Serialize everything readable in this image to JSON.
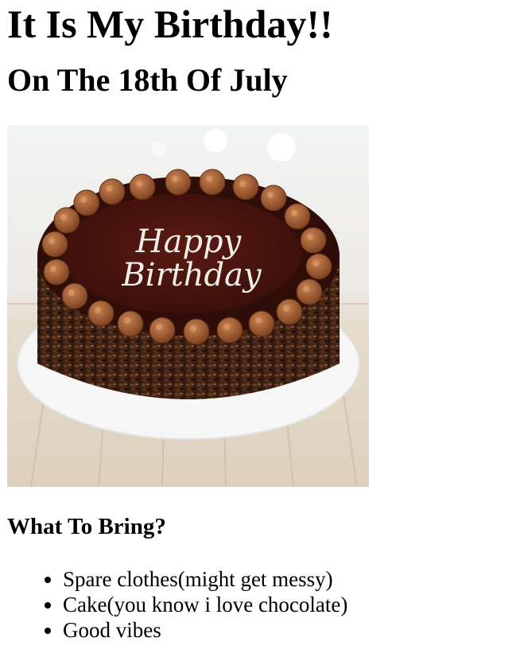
{
  "heading": "It Is My Birthday!!",
  "subheading": "On The 18th Of July",
  "image": {
    "alt": "Chocolate birthday cake",
    "cake_text_line1": "Happy",
    "cake_text_line2": "Birthday"
  },
  "bring": {
    "title": "What To Bring?",
    "items": [
      "Spare clothes(might get messy)",
      "Cake(you know i love chocolate)",
      "Good vibes"
    ]
  }
}
